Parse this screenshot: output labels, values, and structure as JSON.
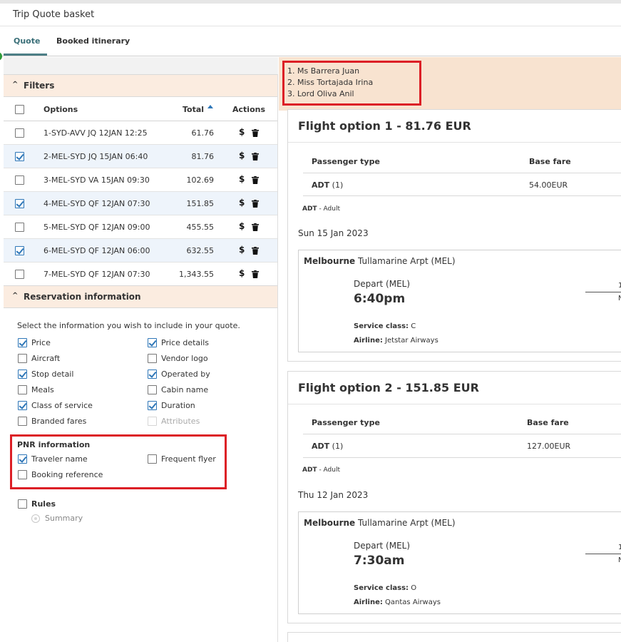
{
  "window": {
    "title": "Trip Quote basket"
  },
  "tabs": [
    {
      "label": "Quote",
      "active": true
    },
    {
      "label": "Booked itinerary",
      "active": false
    }
  ],
  "filters": {
    "section_title": "Filters",
    "headers": {
      "options": "Options",
      "total": "Total",
      "actions": "Actions"
    },
    "rows": [
      {
        "option": "1-SYD-AVV JQ 12JAN 12:25",
        "total": "61.76",
        "checked": false
      },
      {
        "option": "2-MEL-SYD JQ 15JAN 06:40",
        "total": "81.76",
        "checked": true
      },
      {
        "option": "3-MEL-SYD VA 15JAN 09:30",
        "total": "102.69",
        "checked": false
      },
      {
        "option": "4-MEL-SYD QF 12JAN 07:30",
        "total": "151.85",
        "checked": true
      },
      {
        "option": "5-MEL-SYD QF 12JAN 09:00",
        "total": "455.55",
        "checked": false
      },
      {
        "option": "6-MEL-SYD QF 12JAN 06:00",
        "total": "632.55",
        "checked": true
      },
      {
        "option": "7-MEL-SYD QF 12JAN 07:30",
        "total": "1,343.55",
        "checked": false
      }
    ],
    "dollar_symbol": "$"
  },
  "reservation": {
    "section_title": "Reservation information",
    "intro": "Select the information you wish to include in your quote.",
    "left_options": [
      {
        "label": "Price",
        "checked": true
      },
      {
        "label": "Aircraft",
        "checked": false
      },
      {
        "label": "Stop detail",
        "checked": true
      },
      {
        "label": "Meals",
        "checked": false
      },
      {
        "label": "Class of service",
        "checked": true
      },
      {
        "label": "Branded fares",
        "checked": false
      }
    ],
    "right_options": [
      {
        "label": "Price details",
        "checked": true
      },
      {
        "label": "Vendor logo",
        "checked": false
      },
      {
        "label": "Operated by",
        "checked": true
      },
      {
        "label": "Cabin name",
        "checked": false
      },
      {
        "label": "Duration",
        "checked": true
      },
      {
        "label": "Attributes",
        "checked": false,
        "disabled": true
      }
    ],
    "pnr": {
      "title": "PNR information",
      "traveler_name": "Traveler name",
      "traveler_name_checked": true,
      "frequent_flyer": "Frequent flyer",
      "frequent_flyer_checked": false,
      "booking_reference": "Booking reference",
      "booking_reference_checked": false
    },
    "rules": {
      "label": "Rules",
      "checked": false,
      "summary": "Summary"
    }
  },
  "passengers": [
    "1. Ms Barrera Juan",
    "2. Miss Tortajada Irina",
    "3. Lord Oliva Anil"
  ],
  "flight_options": [
    {
      "title": "Flight option 1 - 81.76 EUR",
      "col_passenger_type": "Passenger type",
      "col_base_fare": "Base fare",
      "pax_type": "ADT",
      "pax_count": "(1)",
      "base_fare": "54.00EUR",
      "legend_code": "ADT",
      "legend_text": "- Adult",
      "date": "Sun 15 Jan 2023",
      "city": "Melbourne",
      "airport": "Tullamarine Arpt (MEL)",
      "depart_label": "Depart (MEL)",
      "depart_time": "6:40pm",
      "service_class_label": "Service class:",
      "service_class": "C",
      "airline_label": "Airline:",
      "airline": "Jetstar Airways",
      "trunc_top": "1",
      "trunc_bottom": "N"
    },
    {
      "title": "Flight option 2 - 151.85 EUR",
      "col_passenger_type": "Passenger type",
      "col_base_fare": "Base fare",
      "pax_type": "ADT",
      "pax_count": "(1)",
      "base_fare": "127.00EUR",
      "legend_code": "ADT",
      "legend_text": "- Adult",
      "date": "Thu 12 Jan 2023",
      "city": "Melbourne",
      "airport": "Tullamarine Arpt (MEL)",
      "depart_label": "Depart (MEL)",
      "depart_time": "7:30am",
      "service_class_label": "Service class:",
      "service_class": "O",
      "airline_label": "Airline:",
      "airline": "Qantas Airways",
      "trunc_top": "1",
      "trunc_bottom": "N"
    }
  ]
}
